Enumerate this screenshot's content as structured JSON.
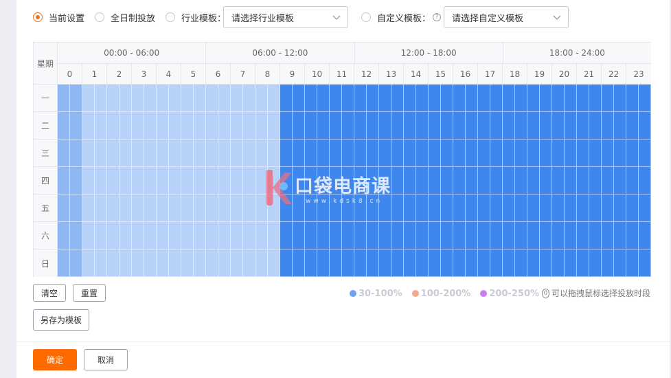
{
  "mode_options": [
    {
      "label": "当前设置",
      "checked": true
    },
    {
      "label": "全日制投放",
      "checked": false
    },
    {
      "label": "行业模板：",
      "checked": false
    },
    {
      "label": "自定义模板：",
      "checked": false
    }
  ],
  "industry_select": {
    "placeholder": "请选择行业模板"
  },
  "custom_select": {
    "placeholder": "请选择自定义模板"
  },
  "help_glyph": "?",
  "grid": {
    "week_header": "星期",
    "ranges": [
      "00:00 - 06:00",
      "06:00 - 12:00",
      "12:00 - 18:00",
      "18:00 - 24:00"
    ],
    "hours": [
      "0",
      "1",
      "2",
      "3",
      "4",
      "5",
      "6",
      "7",
      "8",
      "9",
      "10",
      "11",
      "12",
      "13",
      "14",
      "15",
      "16",
      "17",
      "18",
      "19",
      "20",
      "21",
      "22",
      "23"
    ],
    "days": [
      "一",
      "二",
      "三",
      "四",
      "五",
      "六",
      "日"
    ],
    "slot_levels": [
      2,
      2,
      1,
      1,
      1,
      1,
      1,
      1,
      1,
      1,
      1,
      1,
      1,
      1,
      1,
      1,
      1,
      1,
      3,
      3,
      3,
      3,
      3,
      3,
      3,
      3,
      3,
      3,
      3,
      3,
      3,
      3,
      3,
      3,
      3,
      3,
      3,
      3,
      3,
      3,
      3,
      3,
      3,
      3,
      3,
      3,
      3,
      3
    ],
    "level_colors": {
      "1": "#b7d1f9",
      "2": "#8eb7f4",
      "3": "#3f86ed"
    }
  },
  "watermark": {
    "title": "口袋电商课",
    "url": "www.kdsk8.cn"
  },
  "buttons": {
    "clear": "清空",
    "reset": "重置",
    "save_template": "另存为模板",
    "ok": "确定",
    "cancel": "取消"
  },
  "legend": [
    {
      "label": "30-100%",
      "color": "#6fa3f0"
    },
    {
      "label": "100-200%",
      "color": "#f3a98a"
    },
    {
      "label": "200-250%",
      "color": "#c77dea"
    }
  ],
  "hint": {
    "glyph": "0",
    "text": "可以拖拽鼠标选择投放时段"
  }
}
